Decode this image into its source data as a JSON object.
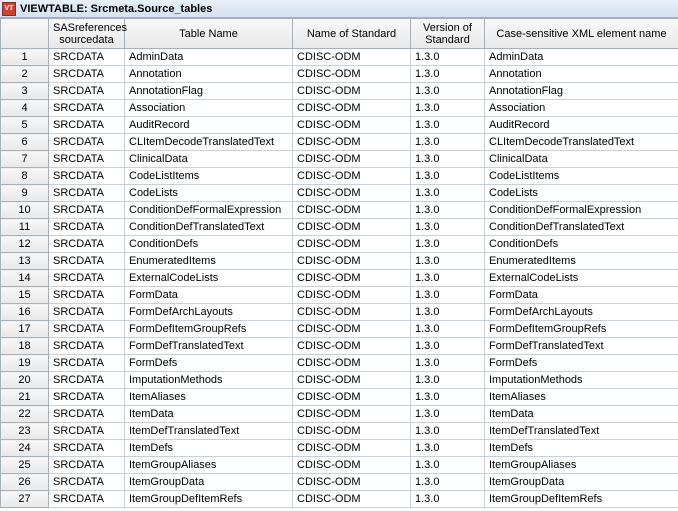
{
  "titlebar": {
    "icon_char": "VT",
    "title": "VIEWTABLE: Srcmeta.Source_tables"
  },
  "columns": {
    "rownum": "",
    "sourcedata": "SASreferences sourcedata",
    "tablename": "Table Name",
    "standard": "Name of Standard",
    "version": "Version of Standard",
    "xmlname": "Case-sensitive XML element name"
  },
  "rows": [
    {
      "n": "1",
      "src": "SRCDATA",
      "tbl": "AdminData",
      "std": "CDISC-ODM",
      "ver": "1.3.0",
      "xml": "AdminData"
    },
    {
      "n": "2",
      "src": "SRCDATA",
      "tbl": "Annotation",
      "std": "CDISC-ODM",
      "ver": "1.3.0",
      "xml": "Annotation"
    },
    {
      "n": "3",
      "src": "SRCDATA",
      "tbl": "AnnotationFlag",
      "std": "CDISC-ODM",
      "ver": "1.3.0",
      "xml": "AnnotationFlag"
    },
    {
      "n": "4",
      "src": "SRCDATA",
      "tbl": "Association",
      "std": "CDISC-ODM",
      "ver": "1.3.0",
      "xml": "Association"
    },
    {
      "n": "5",
      "src": "SRCDATA",
      "tbl": "AuditRecord",
      "std": "CDISC-ODM",
      "ver": "1.3.0",
      "xml": "AuditRecord"
    },
    {
      "n": "6",
      "src": "SRCDATA",
      "tbl": "CLItemDecodeTranslatedText",
      "std": "CDISC-ODM",
      "ver": "1.3.0",
      "xml": "CLItemDecodeTranslatedText"
    },
    {
      "n": "7",
      "src": "SRCDATA",
      "tbl": "ClinicalData",
      "std": "CDISC-ODM",
      "ver": "1.3.0",
      "xml": "ClinicalData"
    },
    {
      "n": "8",
      "src": "SRCDATA",
      "tbl": "CodeListItems",
      "std": "CDISC-ODM",
      "ver": "1.3.0",
      "xml": "CodeListItems"
    },
    {
      "n": "9",
      "src": "SRCDATA",
      "tbl": "CodeLists",
      "std": "CDISC-ODM",
      "ver": "1.3.0",
      "xml": "CodeLists"
    },
    {
      "n": "10",
      "src": "SRCDATA",
      "tbl": "ConditionDefFormalExpression",
      "std": "CDISC-ODM",
      "ver": "1.3.0",
      "xml": "ConditionDefFormalExpression"
    },
    {
      "n": "11",
      "src": "SRCDATA",
      "tbl": "ConditionDefTranslatedText",
      "std": "CDISC-ODM",
      "ver": "1.3.0",
      "xml": "ConditionDefTranslatedText"
    },
    {
      "n": "12",
      "src": "SRCDATA",
      "tbl": "ConditionDefs",
      "std": "CDISC-ODM",
      "ver": "1.3.0",
      "xml": "ConditionDefs"
    },
    {
      "n": "13",
      "src": "SRCDATA",
      "tbl": "EnumeratedItems",
      "std": "CDISC-ODM",
      "ver": "1.3.0",
      "xml": "EnumeratedItems"
    },
    {
      "n": "14",
      "src": "SRCDATA",
      "tbl": "ExternalCodeLists",
      "std": "CDISC-ODM",
      "ver": "1.3.0",
      "xml": "ExternalCodeLists"
    },
    {
      "n": "15",
      "src": "SRCDATA",
      "tbl": "FormData",
      "std": "CDISC-ODM",
      "ver": "1.3.0",
      "xml": "FormData"
    },
    {
      "n": "16",
      "src": "SRCDATA",
      "tbl": "FormDefArchLayouts",
      "std": "CDISC-ODM",
      "ver": "1.3.0",
      "xml": "FormDefArchLayouts"
    },
    {
      "n": "17",
      "src": "SRCDATA",
      "tbl": "FormDefItemGroupRefs",
      "std": "CDISC-ODM",
      "ver": "1.3.0",
      "xml": "FormDefItemGroupRefs"
    },
    {
      "n": "18",
      "src": "SRCDATA",
      "tbl": "FormDefTranslatedText",
      "std": "CDISC-ODM",
      "ver": "1.3.0",
      "xml": "FormDefTranslatedText"
    },
    {
      "n": "19",
      "src": "SRCDATA",
      "tbl": "FormDefs",
      "std": "CDISC-ODM",
      "ver": "1.3.0",
      "xml": "FormDefs"
    },
    {
      "n": "20",
      "src": "SRCDATA",
      "tbl": "ImputationMethods",
      "std": "CDISC-ODM",
      "ver": "1.3.0",
      "xml": "ImputationMethods"
    },
    {
      "n": "21",
      "src": "SRCDATA",
      "tbl": "ItemAliases",
      "std": "CDISC-ODM",
      "ver": "1.3.0",
      "xml": "ItemAliases"
    },
    {
      "n": "22",
      "src": "SRCDATA",
      "tbl": "ItemData",
      "std": "CDISC-ODM",
      "ver": "1.3.0",
      "xml": "ItemData"
    },
    {
      "n": "23",
      "src": "SRCDATA",
      "tbl": "ItemDefTranslatedText",
      "std": "CDISC-ODM",
      "ver": "1.3.0",
      "xml": "ItemDefTranslatedText"
    },
    {
      "n": "24",
      "src": "SRCDATA",
      "tbl": "ItemDefs",
      "std": "CDISC-ODM",
      "ver": "1.3.0",
      "xml": "ItemDefs"
    },
    {
      "n": "25",
      "src": "SRCDATA",
      "tbl": "ItemGroupAliases",
      "std": "CDISC-ODM",
      "ver": "1.3.0",
      "xml": "ItemGroupAliases"
    },
    {
      "n": "26",
      "src": "SRCDATA",
      "tbl": "ItemGroupData",
      "std": "CDISC-ODM",
      "ver": "1.3.0",
      "xml": "ItemGroupData"
    },
    {
      "n": "27",
      "src": "SRCDATA",
      "tbl": "ItemGroupDefItemRefs",
      "std": "CDISC-ODM",
      "ver": "1.3.0",
      "xml": "ItemGroupDefItemRefs"
    }
  ]
}
